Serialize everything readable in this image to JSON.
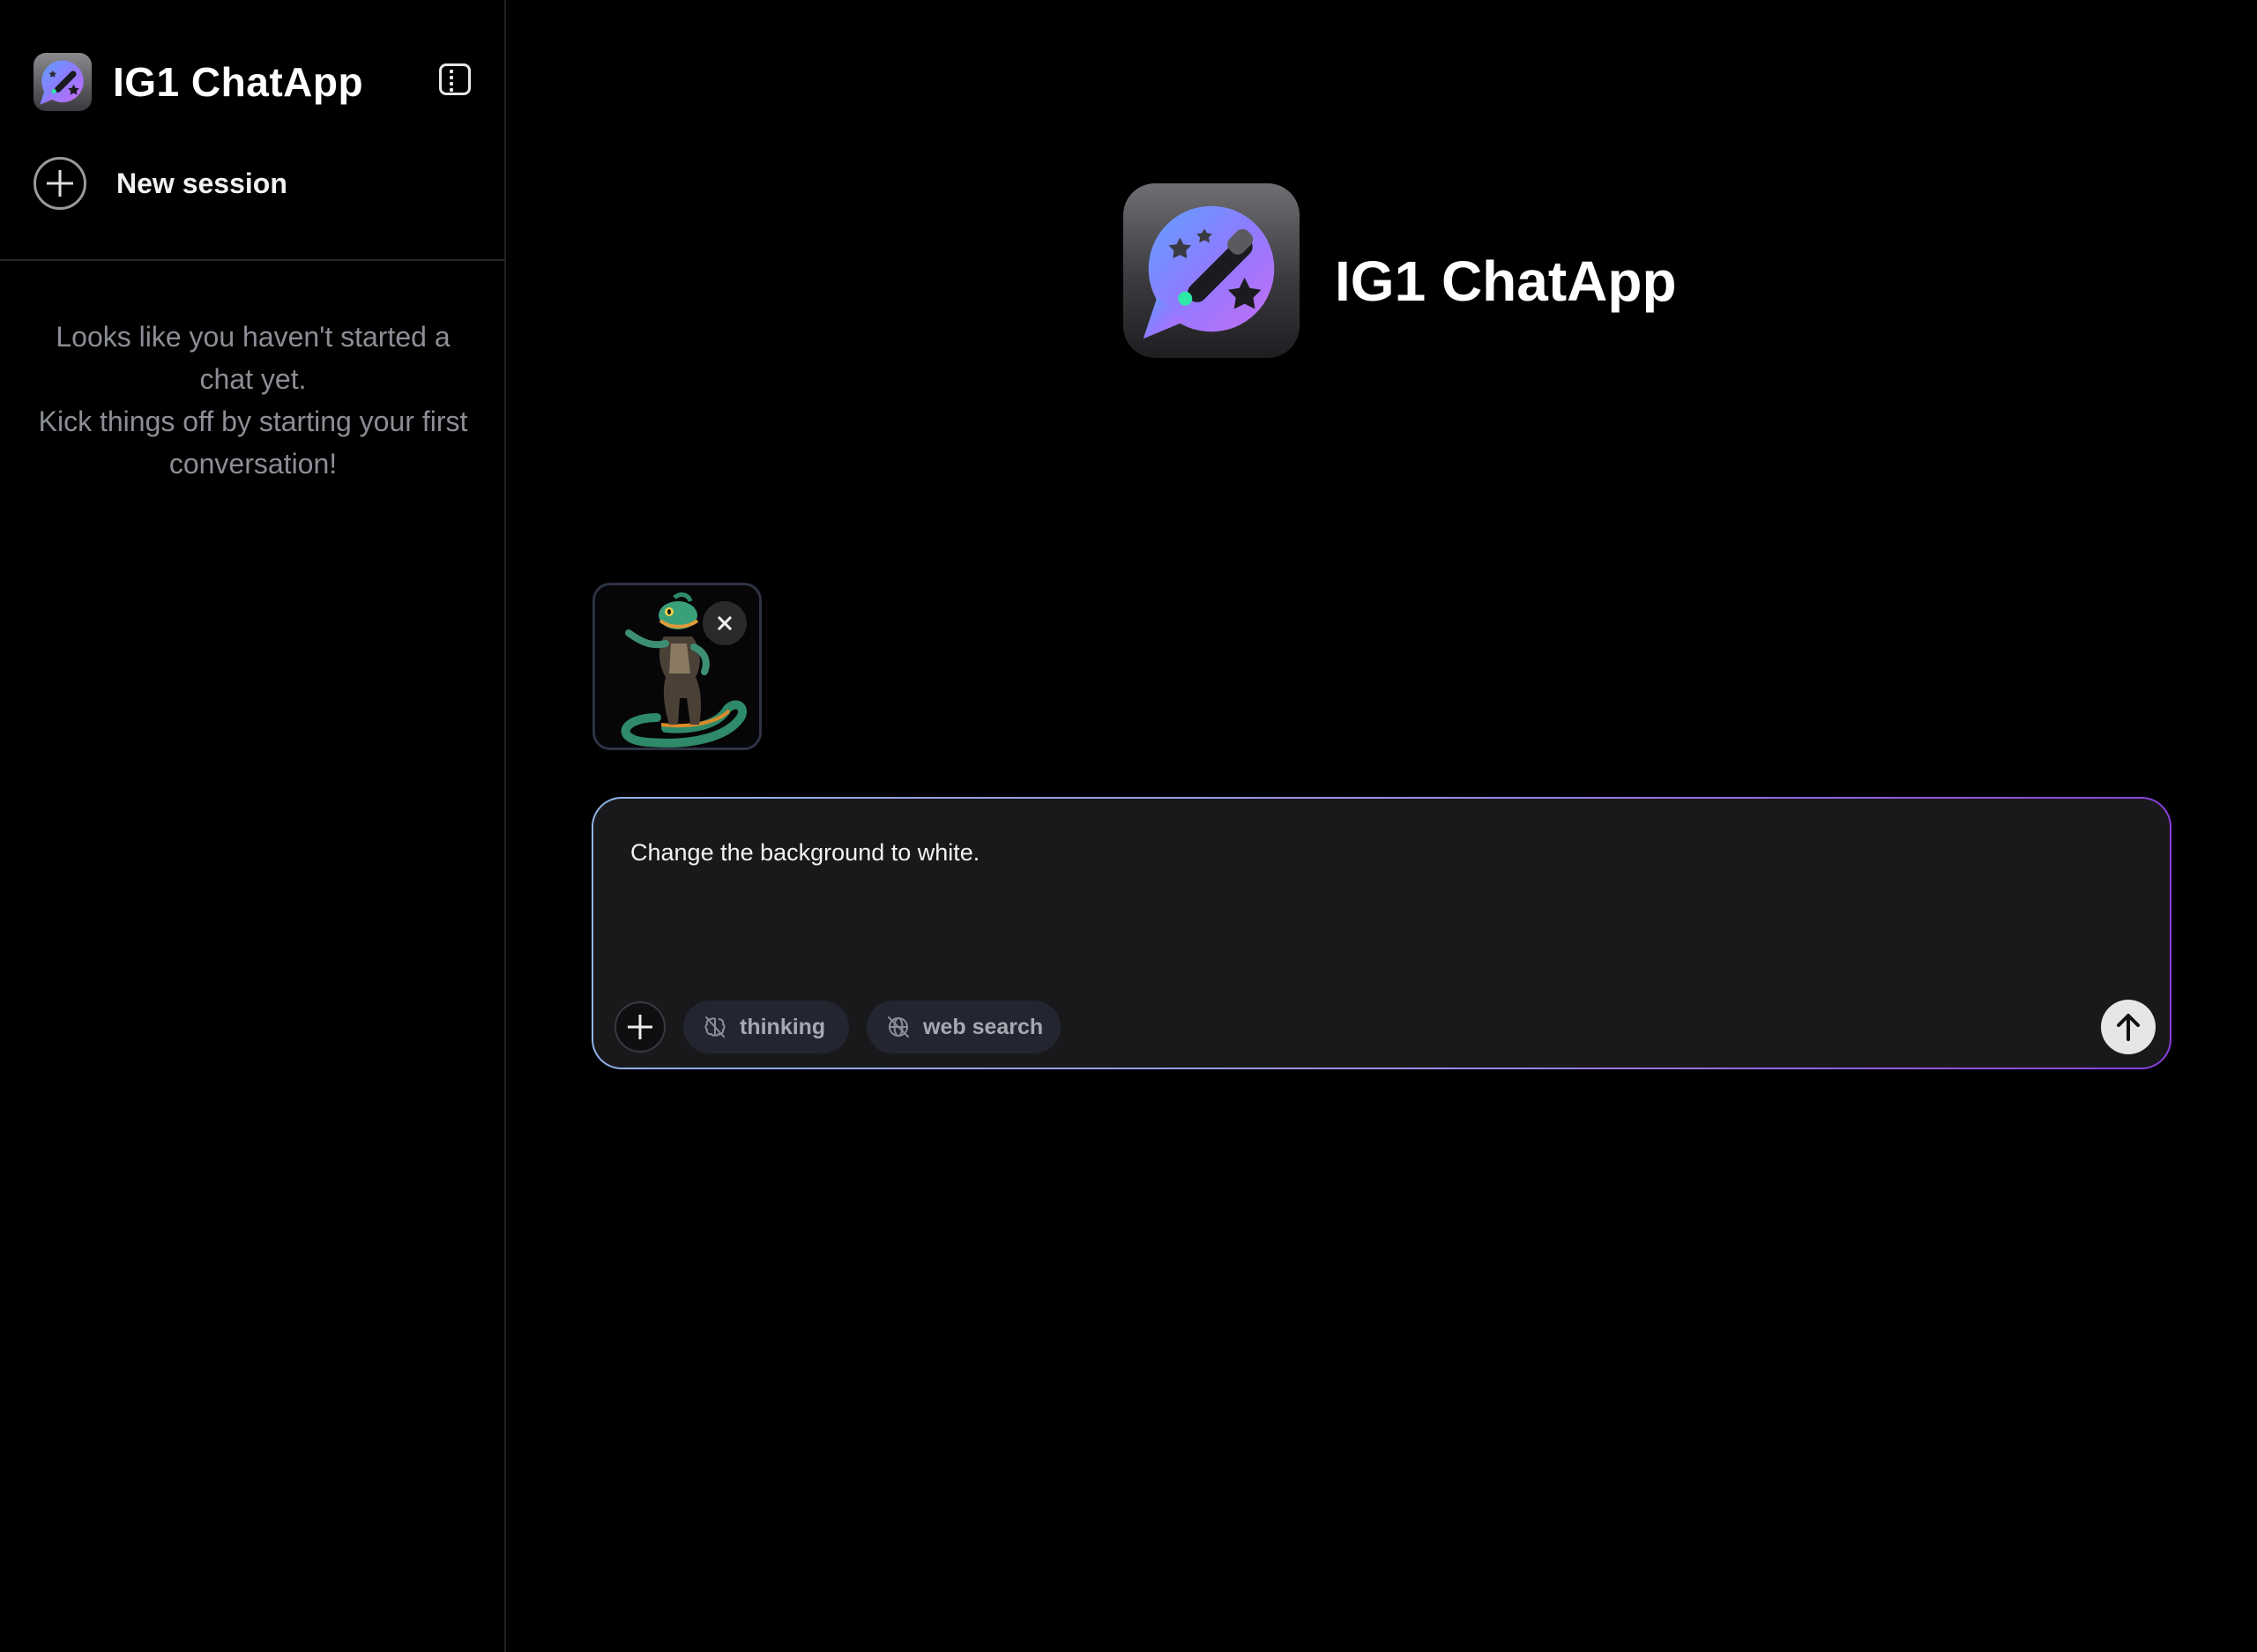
{
  "app": {
    "title": "IG1 ChatApp"
  },
  "sidebar": {
    "title": "IG1 ChatApp",
    "toggle_icon": "sidebar-toggle-icon",
    "new_session_label": "New session",
    "empty_line1": "Looks like you haven't started a chat yet.",
    "empty_line2": "Kick things off by starting your first conversation!"
  },
  "main": {
    "brand_title": "IG1 ChatApp",
    "attachment": {
      "icon": "lizard-image-thumbnail",
      "remove_icon": "close-icon"
    },
    "composer": {
      "value": "Change the background to white.",
      "chips": [
        {
          "label": "thinking",
          "icon": "brain-off-icon"
        },
        {
          "label": "web search",
          "icon": "globe-off-icon"
        }
      ],
      "send_icon": "arrow-up-icon"
    }
  },
  "colors": {
    "background": "#000000",
    "composer_bg": "#19191b",
    "accent_gradient_start": "#8fb3e8",
    "accent_gradient_end": "#8a3fd8",
    "chip_bg": "#232630"
  }
}
